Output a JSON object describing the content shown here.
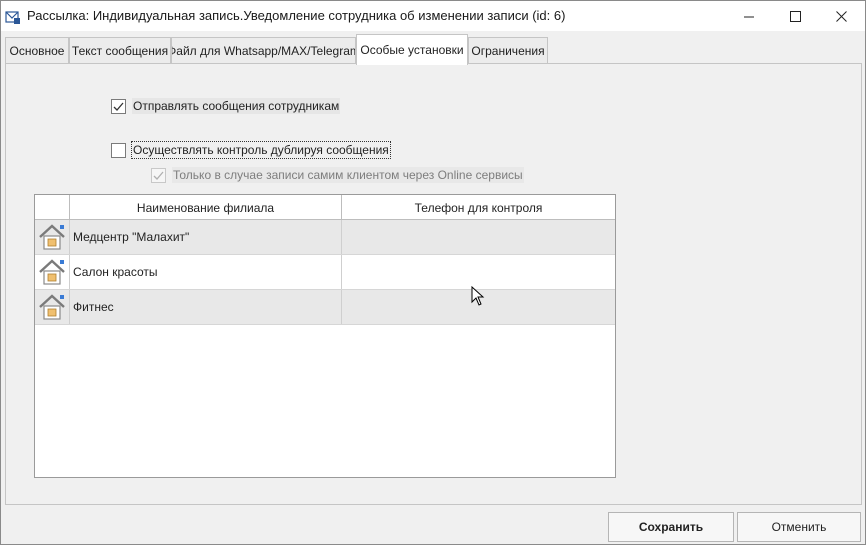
{
  "window": {
    "title": "Рассылка: Индивидуальная запись.Уведомление сотрудника об изменении записи (id: 6)",
    "icons": {
      "app": "mail-window-icon",
      "minimize": "minimize-icon",
      "maximize": "maximize-icon",
      "close": "close-icon"
    }
  },
  "tabs": [
    {
      "label": "Основное",
      "active": false
    },
    {
      "label": "Текст сообщения",
      "active": false
    },
    {
      "label": "Файл для Whatsapp/MAX/Telegram",
      "active": false
    },
    {
      "label": "Особые установки",
      "active": true
    },
    {
      "label": "Ограничения",
      "active": false
    }
  ],
  "options": {
    "send_to_employees": {
      "label": "Отправлять сообщения сотрудникам",
      "checked": true
    },
    "duplicate_control": {
      "label": "Осуществлять контроль дублируя сообщения",
      "checked": false
    },
    "online_only": {
      "label": "Только в случае записи самим клиентом через Online сервисы",
      "checked": true,
      "disabled": true
    }
  },
  "grid": {
    "columns": [
      "",
      "Наименование филиала",
      "Телефон для контроля"
    ],
    "rows": [
      {
        "icon": "branch-house-icon",
        "name": "Медцентр \"Малахит\"",
        "phone": ""
      },
      {
        "icon": "branch-house-icon",
        "name": "Салон красоты",
        "phone": ""
      },
      {
        "icon": "branch-house-icon",
        "name": "Фитнес",
        "phone": ""
      }
    ]
  },
  "footer": {
    "save_label": "Сохранить",
    "cancel_label": "Отменить"
  },
  "colors": {
    "row_alt": "#e8e8e8",
    "border": "#c5c5c5",
    "house_roof": "#7a7a7a",
    "house_window": "#f0c070",
    "house_flag": "#3a7bd5"
  }
}
